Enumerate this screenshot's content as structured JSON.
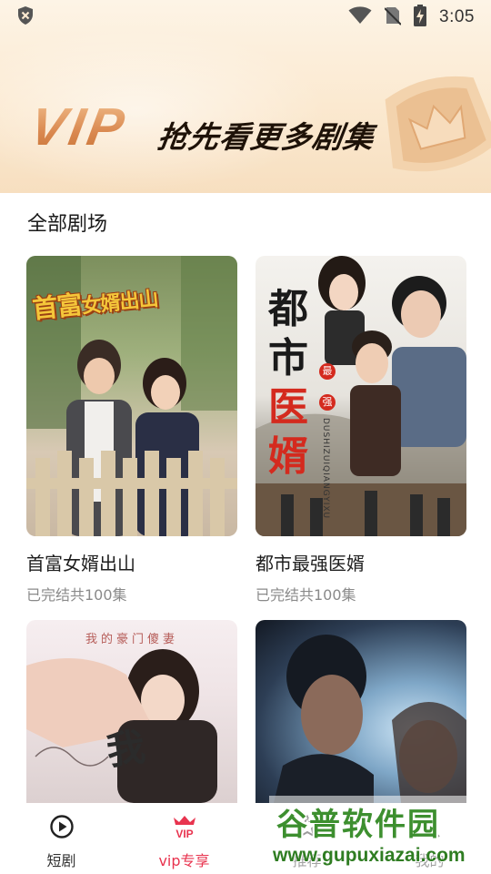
{
  "status_bar": {
    "time": "3:05",
    "icons": [
      "shield-icon",
      "wifi-icon",
      "no-sim-icon",
      "battery-charging-icon"
    ]
  },
  "hero": {
    "vip_text": "VIP",
    "slogan": "抢先看更多剧集",
    "badge_icon": "crown-badge-icon"
  },
  "section": {
    "title": "全部剧场"
  },
  "dramas": [
    {
      "title": "首富女婿出山",
      "subtitle": "已完结共100集",
      "cover_big": "首富",
      "cover_small": "女婿出山"
    },
    {
      "title": "都市最强医婿",
      "subtitle": "已完结共100集",
      "cover_line1": "都市",
      "cover_mark1": "最",
      "cover_line2": "医",
      "cover_mark2": "强",
      "cover_line3": "婿",
      "cover_pinyin": "DUSHIZUIQIANGYIXU"
    },
    {
      "title": "",
      "subtitle": "",
      "cover_top": "我的豪门傻妻",
      "cover_big": "我"
    },
    {
      "title": "",
      "subtitle": ""
    }
  ],
  "bottom_nav": {
    "items": [
      {
        "label": "短剧",
        "icon": "play-circle-icon",
        "active": false
      },
      {
        "label": "vip专享",
        "icon": "vip-crown-icon",
        "active": true
      },
      {
        "label": "推荐",
        "icon": "recommend-icon",
        "active": false
      },
      {
        "label": "我的",
        "icon": "profile-icon",
        "active": false
      }
    ]
  },
  "watermark": {
    "text": "谷普软件园",
    "url": "www.gupuxiazai.com"
  },
  "colors": {
    "accent": "#e8344f",
    "hero_gold": "#d9874e",
    "watermark_green": "#3d8f2f"
  }
}
